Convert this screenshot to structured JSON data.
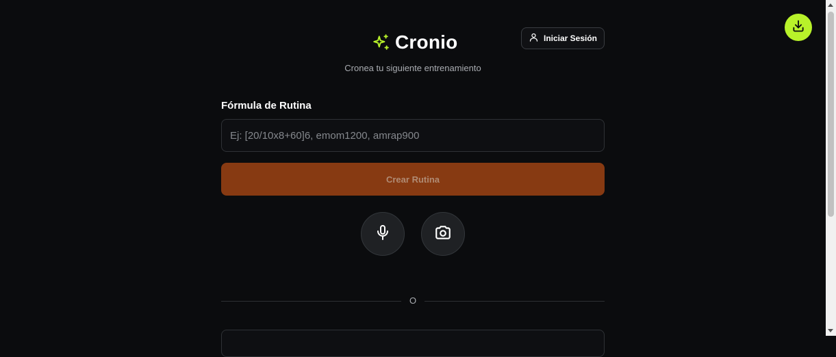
{
  "header": {
    "title": "Cronio",
    "subtitle": "Cronea tu siguiente entrenamiento",
    "logo_icon": "sparkles-icon",
    "accent_color": "#b8f22a"
  },
  "auth": {
    "login_label": "Iniciar Sesión",
    "login_icon": "user-icon"
  },
  "form": {
    "label": "Fórmula de Rutina",
    "input_value": "",
    "input_placeholder": "Ej: [20/10x8+60]6, emom1200, amrap900",
    "submit_label": "Crear Rutina",
    "submit_color": "#873a12"
  },
  "actions": {
    "mic_icon": "microphone-icon",
    "camera_icon": "camera-icon"
  },
  "divider": {
    "text": "O"
  },
  "fab": {
    "icon": "download-icon",
    "color": "#b8f22a"
  }
}
